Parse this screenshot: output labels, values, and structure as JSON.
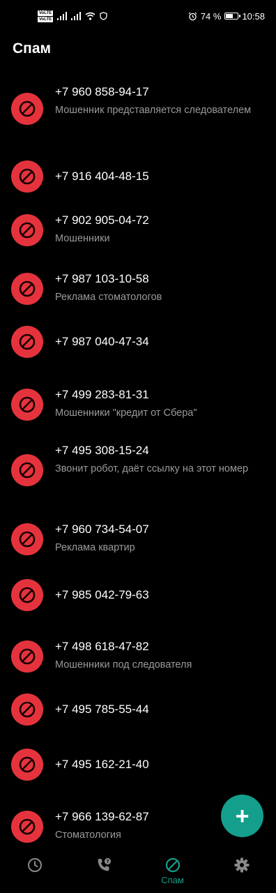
{
  "status_bar": {
    "volte_1": "VoLTE",
    "volte_2": "VoLTE",
    "battery_percent": "74 %",
    "battery_level": 0.74,
    "time": "10:58"
  },
  "header": {
    "title": "Спам"
  },
  "spam_list": [
    {
      "number": "+7 960 858-94-17",
      "note": "Мошенник представляется следователем"
    },
    {
      "number": "+7 916 404-48-15",
      "note": ""
    },
    {
      "number": "+7 902 905-04-72",
      "note": "Мошенники"
    },
    {
      "number": "+7 987 103-10-58",
      "note": "Реклама стоматологов"
    },
    {
      "number": "+7 987 040-47-34",
      "note": ""
    },
    {
      "number": "+7 499 283-81-31",
      "note": "Мошенники \"кредит от Сбера\""
    },
    {
      "number": "+7 495 308-15-24",
      "note": "Звонит робот, даёт ссылку на этот номер"
    },
    {
      "number": "+7 960 734-54-07",
      "note": "Реклама квартир"
    },
    {
      "number": "+7 985 042-79-63",
      "note": ""
    },
    {
      "number": "+7 498 618-47-82",
      "note": "Мошенники под следователя"
    },
    {
      "number": "+7 495 785-55-44",
      "note": ""
    },
    {
      "number": "+7 495 162-21-40",
      "note": ""
    },
    {
      "number": "+7 966 139-62-87",
      "note": "Стоматология"
    }
  ],
  "fab": {
    "label": "+"
  },
  "bottom_nav": {
    "spam_label": "Спам",
    "items": [
      {
        "icon": "clock-icon"
      },
      {
        "icon": "phone-help-icon"
      },
      {
        "icon": "block-icon"
      },
      {
        "icon": "gear-icon"
      }
    ]
  },
  "colors": {
    "background": "#000000",
    "block_red": "#e5333d",
    "accent_teal": "#149f8c",
    "note_gray": "#9a9a9a"
  }
}
